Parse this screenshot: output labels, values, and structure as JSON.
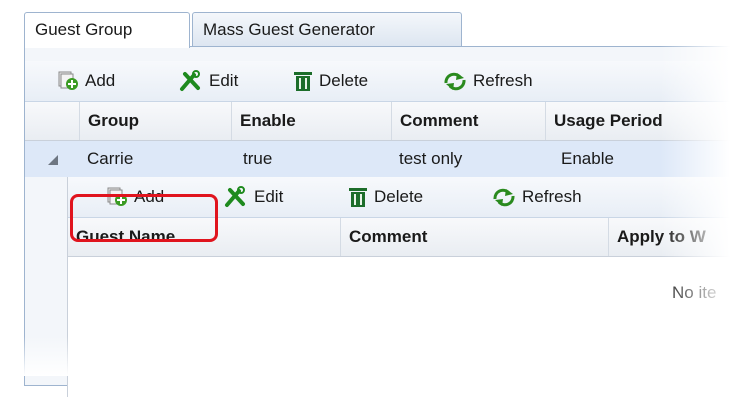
{
  "tabs": [
    {
      "label": "Guest Group"
    },
    {
      "label": "Mass Guest Generator"
    }
  ],
  "group_toolbar": {
    "add_label": "Add",
    "edit_label": "Edit",
    "delete_label": "Delete",
    "refresh_label": "Refresh"
  },
  "group_table": {
    "columns": [
      "Group",
      "Enable",
      "Comment",
      "Usage Period"
    ],
    "rows": [
      {
        "group": "Carrie",
        "enable": "true",
        "comment": "test only",
        "usage_period": "Enable",
        "expanded": true
      }
    ]
  },
  "guest_toolbar": {
    "add_label": "Add",
    "edit_label": "Edit",
    "delete_label": "Delete",
    "refresh_label": "Refresh"
  },
  "guest_table": {
    "columns": [
      "Guest Name",
      "Comment",
      "Apply to W"
    ],
    "empty_text": "No ite"
  },
  "colors": {
    "highlight": "#e0141e",
    "selected_row": "#dde8f8",
    "add_icon": "#3a9b22",
    "edit_icon": "#1e8a1e",
    "delete_icon": "#1c6d2a",
    "refresh_icon": "#2a8a1e"
  }
}
